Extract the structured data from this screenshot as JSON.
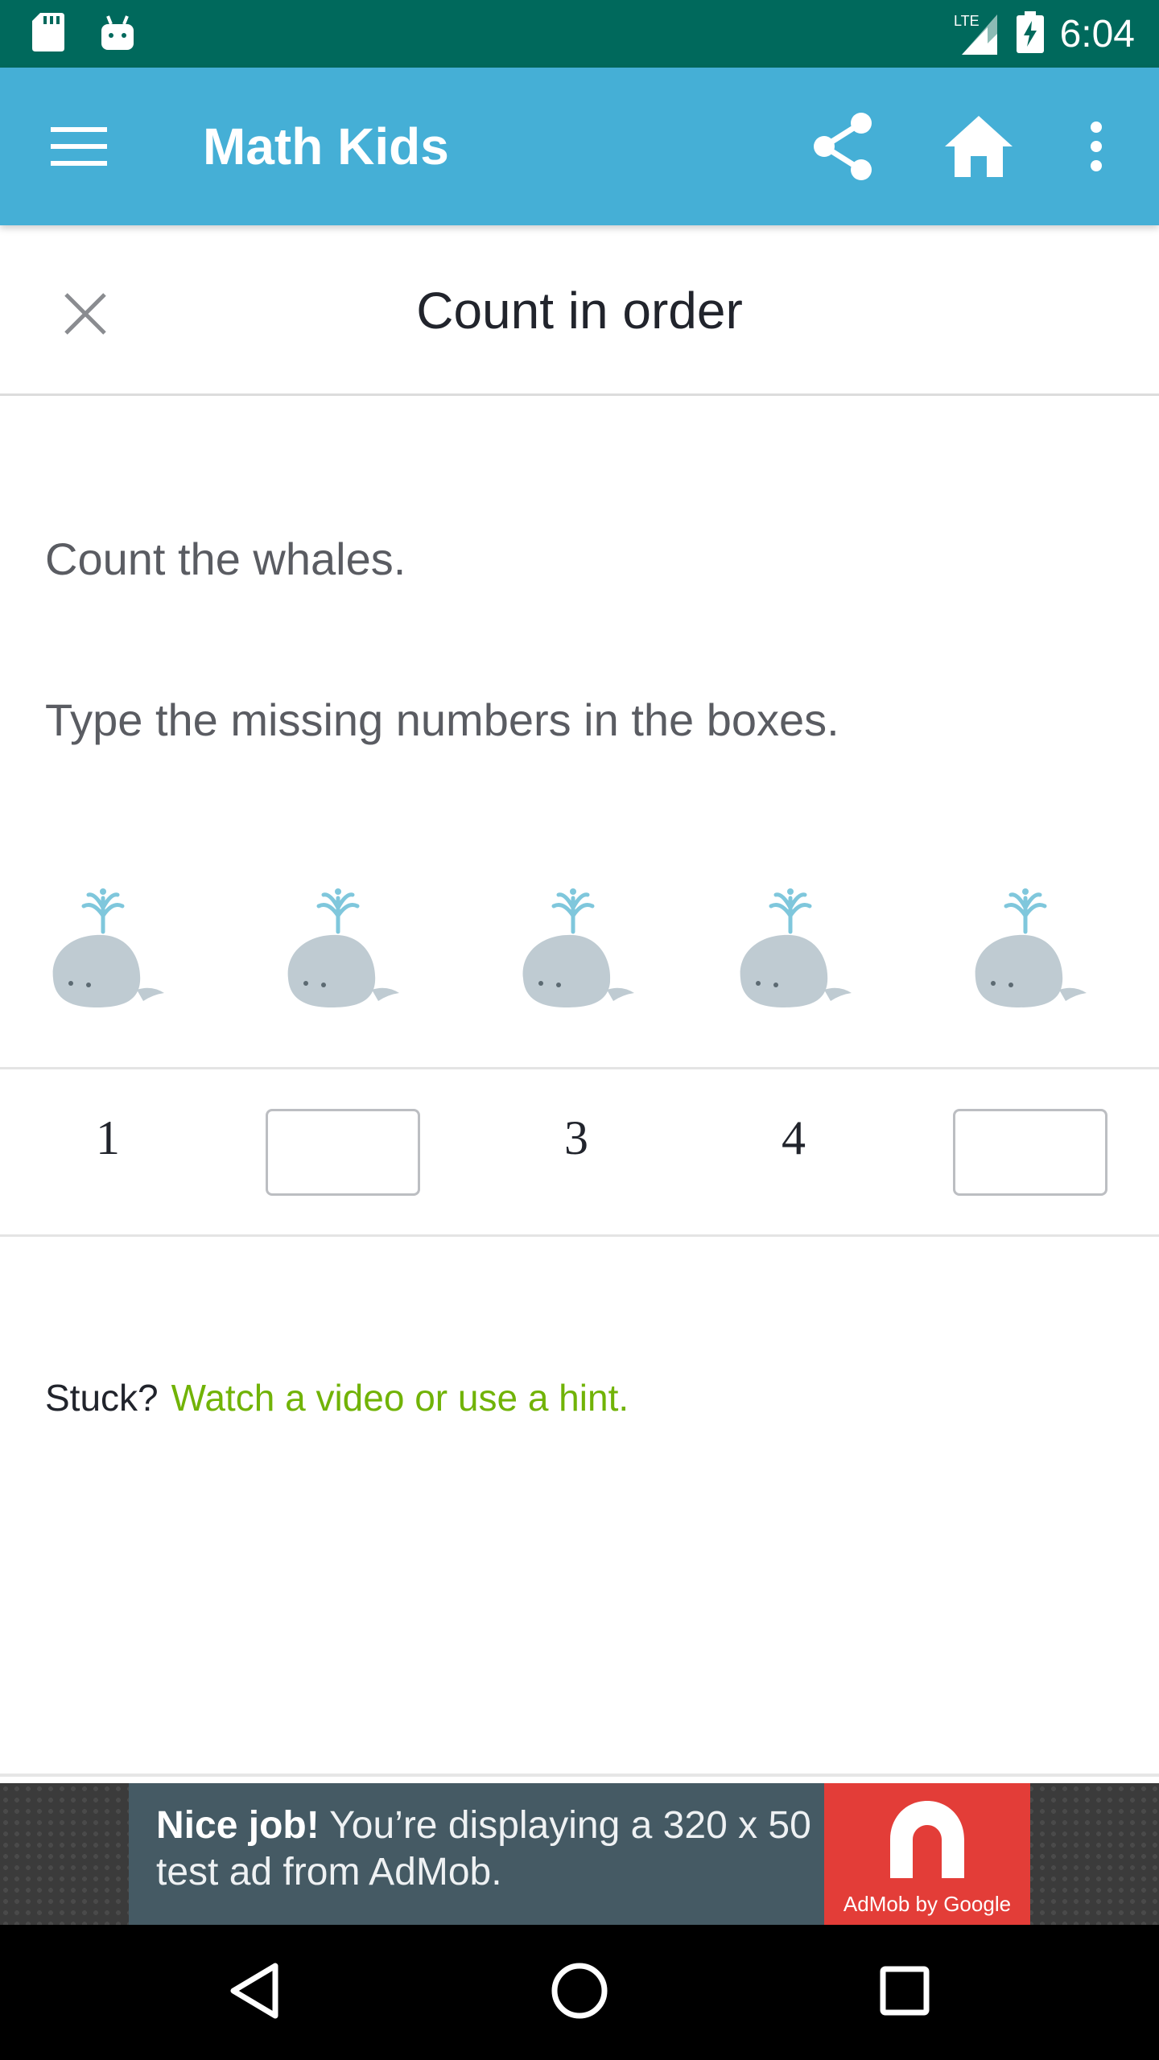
{
  "status_bar": {
    "time": "6:04",
    "network": "LTE",
    "left_icons": [
      "sd-card-icon",
      "android-icon"
    ],
    "right_icons": [
      "signal-icon",
      "battery-charging-icon"
    ]
  },
  "app_bar": {
    "title": "Math Kids",
    "background": "#45afd6",
    "actions": [
      "share-icon",
      "home-icon",
      "more-vert-icon"
    ]
  },
  "exercise": {
    "title": "Count in order",
    "question_line1": "Count the whales.",
    "question_line2": "Type the missing numbers in the boxes.",
    "whale_count": 5,
    "sequence": [
      {
        "type": "number",
        "value": "1"
      },
      {
        "type": "input",
        "value": ""
      },
      {
        "type": "number",
        "value": "3"
      },
      {
        "type": "number",
        "value": "4"
      },
      {
        "type": "input",
        "value": ""
      }
    ]
  },
  "help": {
    "stuck_label": "Stuck?",
    "hint_link": "Watch a video or use a hint.",
    "link_color": "#71b307"
  },
  "ad": {
    "headline": "Nice job!",
    "line1": " You’re displaying a 320 x 50",
    "line2": "test ad from AdMob.",
    "brand": "AdMob by Google"
  },
  "nav_bar": {
    "buttons": [
      "back-icon",
      "home-circle-icon",
      "recents-icon"
    ]
  }
}
